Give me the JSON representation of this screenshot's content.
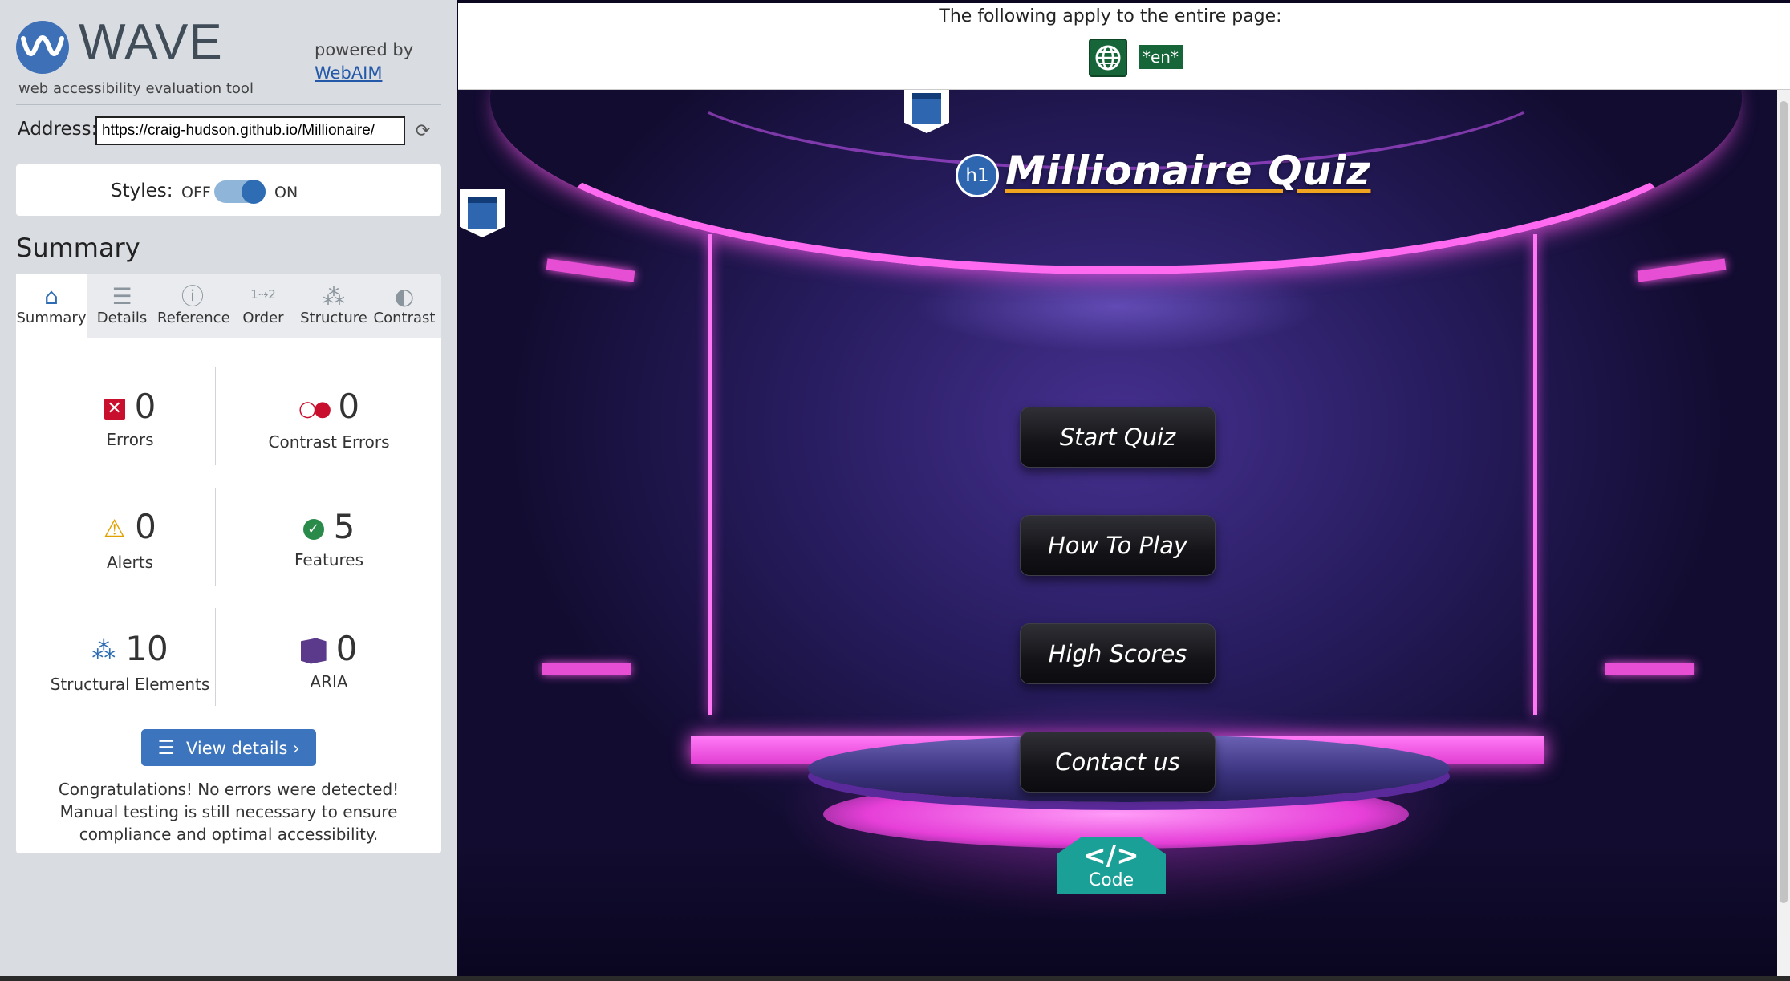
{
  "wave": {
    "logo_text": "WAVE",
    "tagline": "web accessibility evaluation tool",
    "powered_by": "powered by",
    "webaim_link": "WebAIM",
    "address_label": "Address:",
    "address_value": "https://craig-hudson.github.io/Millionaire/",
    "styles_label": "Styles:",
    "styles_off": "OFF",
    "styles_on": "ON",
    "styles_enabled": true,
    "summary_heading": "Summary",
    "tabs": [
      {
        "label": "Summary",
        "icon": "home-icon",
        "active": true
      },
      {
        "label": "Details",
        "icon": "list-icon",
        "active": false
      },
      {
        "label": "Reference",
        "icon": "info-icon",
        "active": false
      },
      {
        "label": "Order",
        "icon": "order-icon",
        "active": false
      },
      {
        "label": "Structure",
        "icon": "structure-icon",
        "active": false
      },
      {
        "label": "Contrast",
        "icon": "contrast-icon",
        "active": false
      }
    ],
    "stats": {
      "errors": {
        "count": "0",
        "label": "Errors"
      },
      "contrast_errors": {
        "count": "0",
        "label": "Contrast Errors"
      },
      "alerts": {
        "count": "0",
        "label": "Alerts"
      },
      "features": {
        "count": "5",
        "label": "Features"
      },
      "structural": {
        "count": "10",
        "label": "Structural Elements"
      },
      "aria": {
        "count": "0",
        "label": "ARIA"
      }
    },
    "view_details": "View details ›",
    "congrats": "Congratulations! No errors were detected! Manual testing is still necessary to ensure compliance and optimal accessibility.",
    "colors": {
      "accent": "#3c74bd",
      "error": "#c8102e",
      "alert": "#e0a100",
      "feature": "#2a8a4a",
      "aria": "#5b3a8c"
    }
  },
  "page": {
    "apply_message": "The following apply to the entire page:",
    "lang_tag": "*en*",
    "h1_badge": "h1",
    "title": "Millionaire Quiz",
    "buttons": [
      "Start Quiz",
      "How To Play",
      "High Scores",
      "Contact us"
    ],
    "code_glyph": "</>",
    "code_label": "Code",
    "colors": {
      "neon": "#ff6af0",
      "title_underline": "#f0a520",
      "code": "#1aa097"
    }
  }
}
